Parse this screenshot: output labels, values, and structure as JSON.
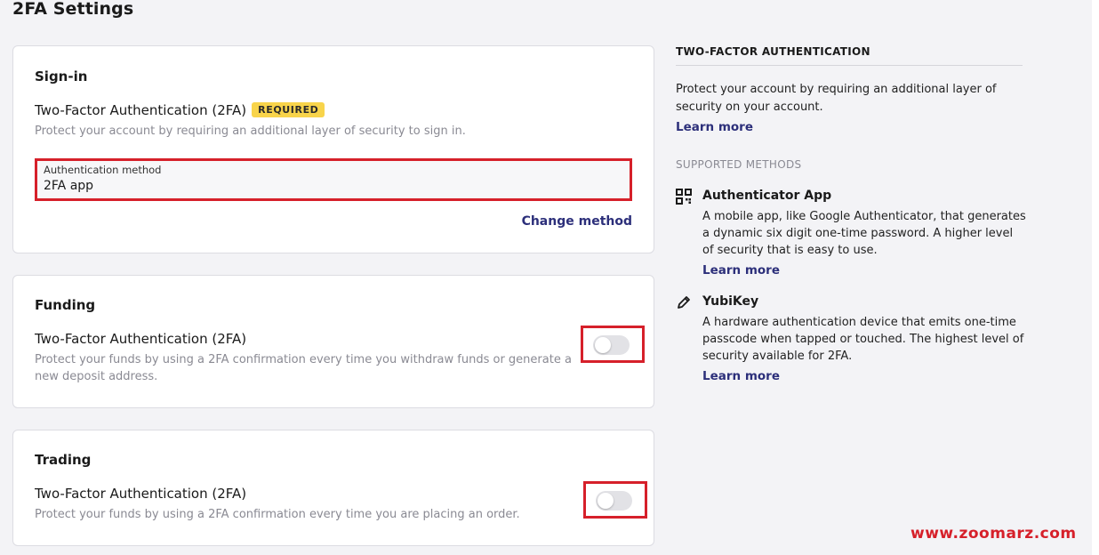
{
  "page": {
    "title": "2FA Settings"
  },
  "signin": {
    "title": "Sign-in",
    "row_title": "Two-Factor Authentication (2FA)",
    "badge": "REQUIRED",
    "row_desc": "Protect your account by requiring an additional layer of security to sign in.",
    "auth_label": "Authentication method",
    "auth_value": "2FA app",
    "change_link": "Change method"
  },
  "funding": {
    "title": "Funding",
    "row_title": "Two-Factor Authentication (2FA)",
    "row_desc": "Protect your funds by using a 2FA confirmation every time you withdraw funds or generate a new deposit address.",
    "toggle_on": false
  },
  "trading": {
    "title": "Trading",
    "row_title": "Two-Factor Authentication (2FA)",
    "row_desc": "Protect your funds by using a 2FA confirmation every time you are placing an order.",
    "toggle_on": false
  },
  "panel": {
    "heading": "TWO-FACTOR AUTHENTICATION",
    "intro": "Protect your account by requiring an additional layer of security on your account.",
    "intro_link": "Learn more",
    "supported_heading": "SUPPORTED METHODS",
    "methods": [
      {
        "icon": "qr-code-icon",
        "title": "Authenticator App",
        "desc": "A mobile app, like Google Authenticator, that generates a dynamic six digit one-time password. A higher level of security that is easy to use.",
        "link": "Learn more"
      },
      {
        "icon": "pencil-key-icon",
        "title": "YubiKey",
        "desc": "A hardware authentication device that emits one-time passcode when tapped or touched. The highest level of security available for 2FA.",
        "link": "Learn more"
      }
    ]
  },
  "watermark": "www.zoomarz.com",
  "colors": {
    "background": "#f3f3f6",
    "card": "#ffffff",
    "badge": "#f8d44b",
    "link": "#2c2f7a",
    "highlight": "#d6202a",
    "muted_text": "#8a8a93"
  }
}
